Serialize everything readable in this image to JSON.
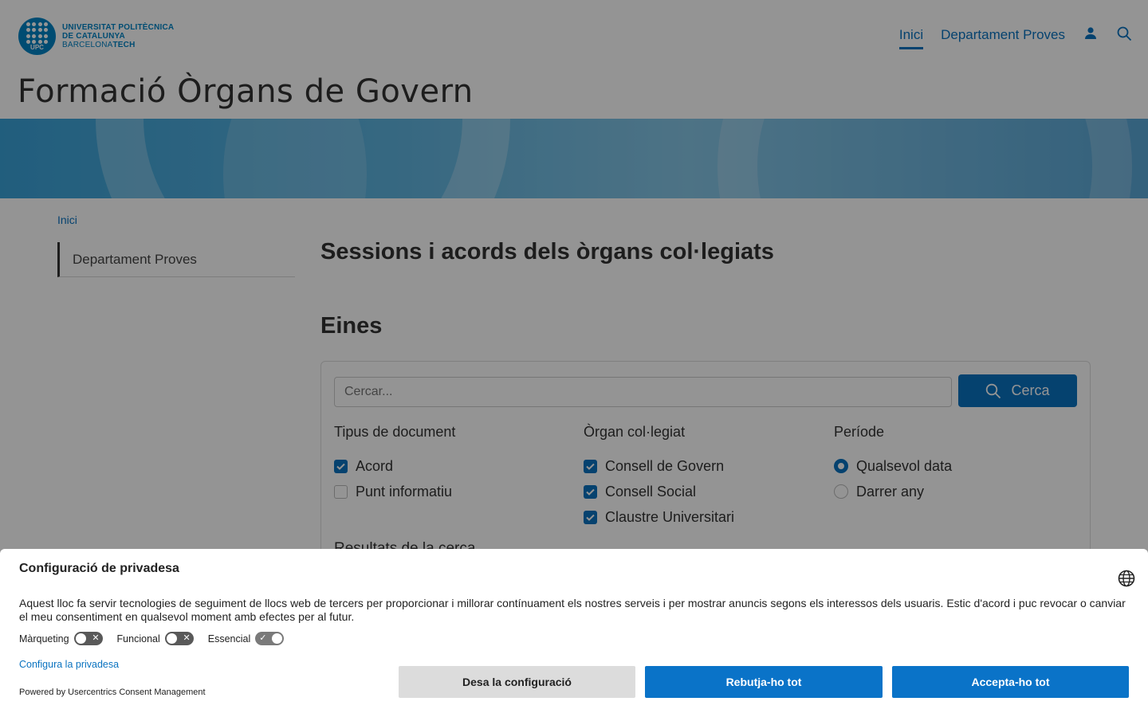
{
  "header": {
    "logo": {
      "abbr": "UPC",
      "line1": "UNIVERSITAT POLITÈCNICA",
      "line2": "DE CATALUNYA",
      "line3_light": "BARCELONA",
      "line3_bold": "TECH"
    },
    "nav": {
      "home": "Inici",
      "department": "Departament Proves"
    },
    "site_title": "Formació Òrgans de Govern"
  },
  "breadcrumb": "Inici",
  "sidebar": {
    "items": [
      {
        "label": "Departament Proves"
      }
    ]
  },
  "main": {
    "title": "Sessions i acords dels òrgans col·legiats",
    "tools_title": "Eines",
    "search": {
      "placeholder": "Cercar...",
      "button_label": "Cerca"
    },
    "filters": {
      "doc_type": {
        "title": "Tipus de document",
        "options": [
          {
            "label": "Acord",
            "checked": true
          },
          {
            "label": "Punt informatiu",
            "checked": false
          }
        ]
      },
      "organ": {
        "title": "Òrgan col·legiat",
        "options": [
          {
            "label": "Consell de Govern",
            "checked": true
          },
          {
            "label": "Consell Social",
            "checked": true
          },
          {
            "label": "Claustre Universitari",
            "checked": true
          }
        ]
      },
      "period": {
        "title": "Període",
        "options": [
          {
            "label": "Qualsevol data",
            "selected": true
          },
          {
            "label": "Darrer any",
            "selected": false
          }
        ]
      }
    },
    "results_label": "Resultats de la cerca"
  },
  "cookie_banner": {
    "title": "Configuració de privadesa",
    "text": "Aquest lloc fa servir tecnologies de seguiment de llocs web de tercers per proporcionar i millorar contínuament els nostres serveis i per mostrar anuncis segons els interessos dels usuaris. Estic d'acord i puc revocar o canviar el meu consentiment en qualsevol moment amb efectes per al futur.",
    "toggles": [
      {
        "label": "Màrqueting",
        "on": false
      },
      {
        "label": "Funcional",
        "on": false
      },
      {
        "label": "Essencial",
        "on": true
      }
    ],
    "config_link": "Configura la privadesa",
    "powered_by": "Powered by Usercentrics Consent Management",
    "buttons": {
      "save": "Desa la configuració",
      "reject": "Rebutja-ho tot",
      "accept": "Accepta-ho tot"
    }
  },
  "colors": {
    "brand": "#0083c5",
    "link": "#0a73c0",
    "button": "#0a73c8"
  }
}
